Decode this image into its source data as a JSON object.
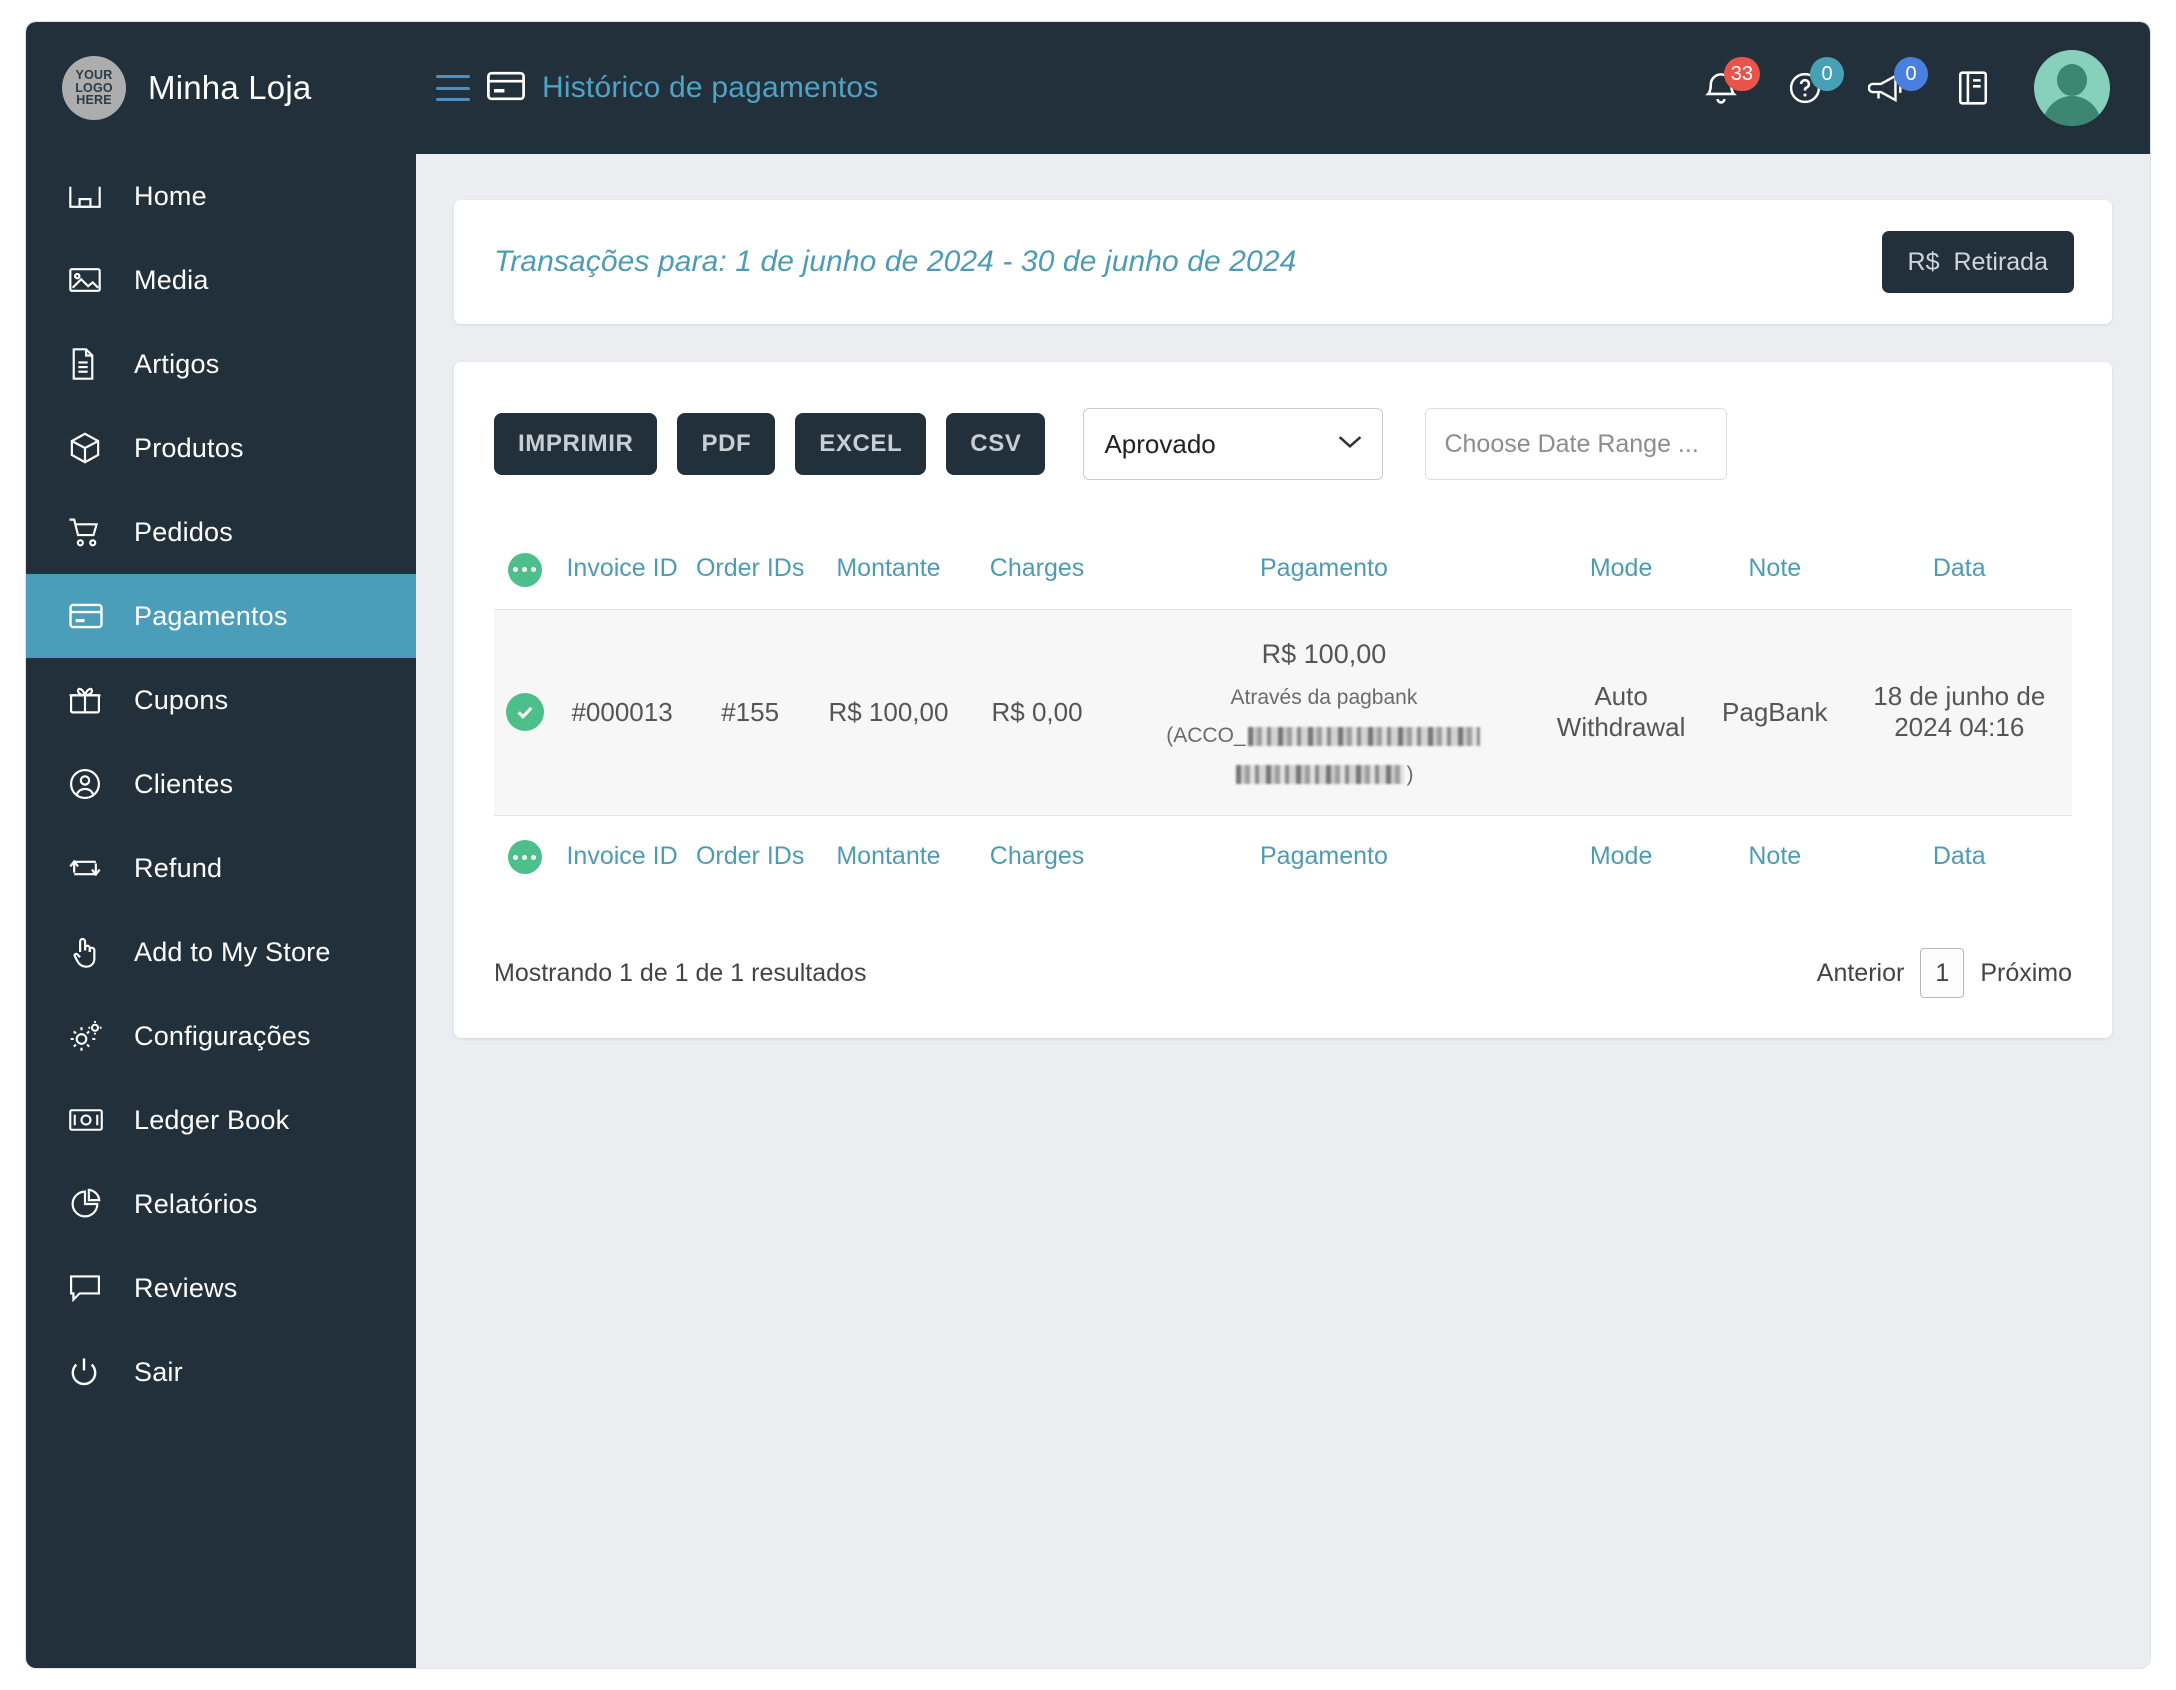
{
  "header": {
    "logo_text_lines": [
      "YOUR",
      "LOGO",
      "HERE"
    ],
    "brand_name": "Minha Loja",
    "breadcrumb_title": "Histórico de pagamentos",
    "notifications_count": "33",
    "help_count": "0",
    "announcements_count": "0",
    "colors": {
      "bar_bg": "#22303C",
      "accent_teal": "#4E9BB4",
      "badge_red": "#E8544A",
      "badge_teal": "#48A0B5",
      "badge_blue": "#4A7FE0"
    }
  },
  "sidebar": {
    "items": [
      {
        "label": "Home",
        "icon": "home-icon",
        "active": false
      },
      {
        "label": "Media",
        "icon": "image-icon",
        "active": false
      },
      {
        "label": "Artigos",
        "icon": "document-icon",
        "active": false
      },
      {
        "label": "Produtos",
        "icon": "box-icon",
        "active": false
      },
      {
        "label": "Pedidos",
        "icon": "cart-icon",
        "active": false
      },
      {
        "label": "Pagamentos",
        "icon": "credit-card-icon",
        "active": true
      },
      {
        "label": "Cupons",
        "icon": "gift-icon",
        "active": false
      },
      {
        "label": "Clientes",
        "icon": "user-circle-icon",
        "active": false
      },
      {
        "label": "Refund",
        "icon": "refund-arrows-icon",
        "active": false
      },
      {
        "label": "Add to My Store",
        "icon": "hand-pointer-icon",
        "active": false
      },
      {
        "label": "Configurações",
        "icon": "gears-icon",
        "active": false
      },
      {
        "label": "Ledger Book",
        "icon": "banknote-icon",
        "active": false
      },
      {
        "label": "Relatórios",
        "icon": "pie-chart-icon",
        "active": false
      },
      {
        "label": "Reviews",
        "icon": "comment-icon",
        "active": false
      },
      {
        "label": "Sair",
        "icon": "power-icon",
        "active": false
      }
    ],
    "active_bg": "#4B9EB9"
  },
  "page_header": {
    "title": "Transações para: 1 de junho de 2024 - 30 de junho de 2024",
    "withdraw_currency": "R$",
    "withdraw_label": "Retirada"
  },
  "toolbar": {
    "print_label": "IMPRIMIR",
    "pdf_label": "PDF",
    "excel_label": "EXCEL",
    "csv_label": "CSV",
    "status_selected": "Aprovado",
    "status_options": [
      "Aprovado"
    ],
    "date_range_placeholder": "Choose Date Range ...",
    "date_range_value": ""
  },
  "table": {
    "columns": [
      {
        "key": "actions",
        "label": ""
      },
      {
        "key": "invoice_id",
        "label": "Invoice ID"
      },
      {
        "key": "order_ids",
        "label": "Order IDs"
      },
      {
        "key": "amount",
        "label": "Montante"
      },
      {
        "key": "charges",
        "label": "Charges"
      },
      {
        "key": "payment",
        "label": "Pagamento"
      },
      {
        "key": "mode",
        "label": "Mode"
      },
      {
        "key": "note",
        "label": "Note"
      },
      {
        "key": "date",
        "label": "Data"
      }
    ],
    "rows": [
      {
        "status_icon": "check-circle-icon",
        "invoice_id": "#000013",
        "order_ids": "#155",
        "amount": "R$ 100,00",
        "charges": "R$ 0,00",
        "payment_amount": "R$ 100,00",
        "payment_via": "Através da pagbank",
        "payment_ref_prefix": "(ACCO_",
        "payment_ref_suffix": ")",
        "payment_ref_redacted": true,
        "mode": "Auto Withdrawal",
        "note": "PagBank",
        "date": "18 de junho de 2024 04:16"
      }
    ]
  },
  "footer": {
    "showing_text": "Mostrando 1 de 1 de 1 resultados",
    "prev_label": "Anterior",
    "current_page": "1",
    "next_label": "Próximo"
  }
}
